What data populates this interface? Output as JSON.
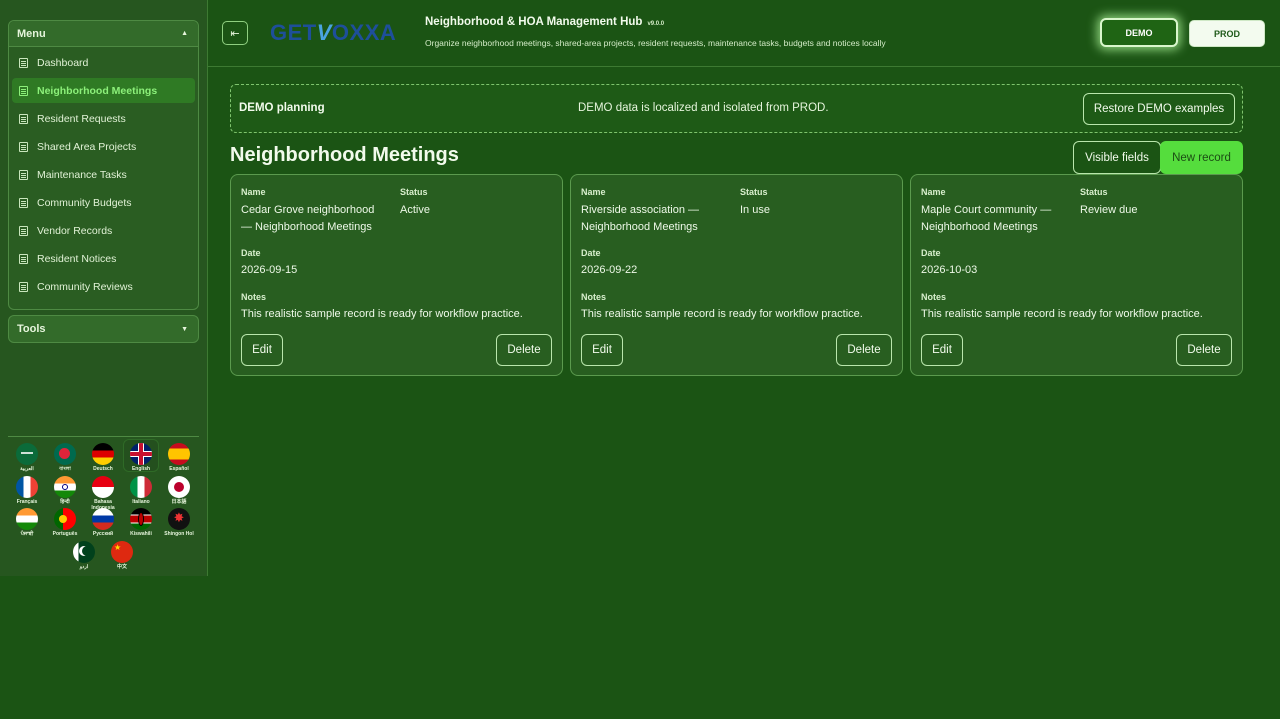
{
  "sidebar": {
    "menu_title": "Menu",
    "tools_title": "Tools",
    "items": [
      {
        "label": "Dashboard"
      },
      {
        "label": "Neighborhood Meetings"
      },
      {
        "label": "Resident Requests"
      },
      {
        "label": "Shared Area Projects"
      },
      {
        "label": "Maintenance Tasks"
      },
      {
        "label": "Community Budgets"
      },
      {
        "label": "Vendor Records"
      },
      {
        "label": "Resident Notices"
      },
      {
        "label": "Community Reviews"
      }
    ],
    "active_index": 1
  },
  "languages": [
    {
      "label": "العربية"
    },
    {
      "label": "বাংলা"
    },
    {
      "label": "Deutsch"
    },
    {
      "label": "English"
    },
    {
      "label": "Español"
    },
    {
      "label": "Français"
    },
    {
      "label": "हिन्दी"
    },
    {
      "label": "Bahasa Indonesia"
    },
    {
      "label": "Italiano"
    },
    {
      "label": "日本語"
    },
    {
      "label": "ਪੰਜਾਬੀ"
    },
    {
      "label": "Português"
    },
    {
      "label": "Русский"
    },
    {
      "label": "Kiswahili"
    },
    {
      "label": "Shingon Hol"
    },
    {
      "label": "اردو"
    },
    {
      "label": "中文"
    }
  ],
  "selected_language": "English",
  "header": {
    "logo_pre": "GET",
    "logo_v": "V",
    "logo_post": "OXXA",
    "title": "Neighborhood & HOA Management Hub",
    "version": "v9.0.0",
    "subtitle": "Organize neighborhood meetings, shared-area projects, resident requests, maintenance tasks, budgets and notices locally",
    "demo_label": "DEMO",
    "prod_label": "PROD"
  },
  "banner": {
    "title": "DEMO planning",
    "message": "DEMO data is localized and isolated from PROD.",
    "restore_label": "Restore DEMO examples"
  },
  "page": {
    "title": "Neighborhood Meetings",
    "visible_fields_label": "Visible fields",
    "new_record_label": "New record"
  },
  "field_labels": {
    "name": "Name",
    "status": "Status",
    "date": "Date",
    "notes": "Notes"
  },
  "card_actions": {
    "edit": "Edit",
    "delete": "Delete"
  },
  "records": [
    {
      "name_line1": "Cedar Grove neighborhood",
      "name_line2": "— Neighborhood Meetings",
      "status": "Active",
      "date": "2026-09-15",
      "notes": "This realistic sample record is ready for workflow practice."
    },
    {
      "name_line1": "Riverside association —",
      "name_line2": "Neighborhood Meetings",
      "status": "In use",
      "date": "2026-09-22",
      "notes": "This realistic sample record is ready for workflow practice."
    },
    {
      "name_line1": "Maple Court community —",
      "name_line2": "Neighborhood Meetings",
      "status": "Review due",
      "date": "2026-10-03",
      "notes": "This realistic sample record is ready for workflow practice."
    }
  ],
  "colors": {
    "background": "#1b5414",
    "sidebar": "#26561f",
    "accent": "#55dd3d",
    "active_text": "#8cf07a"
  }
}
